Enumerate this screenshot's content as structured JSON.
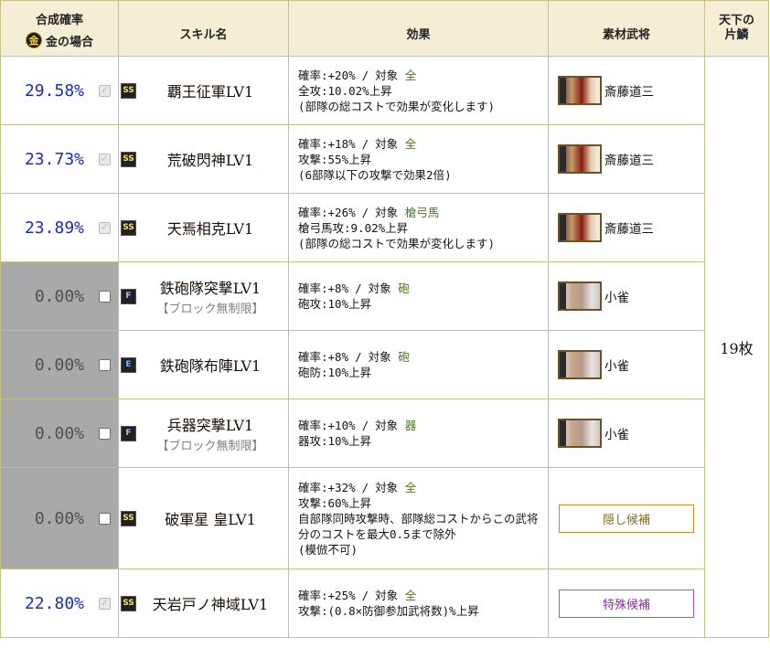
{
  "header": {
    "rate_title": "合成確率",
    "gold_coin": "金",
    "gold_label": "金の場合",
    "skill_name": "スキル名",
    "effect": "効果",
    "material": "素材武将",
    "scale_line1": "天下の",
    "scale_line2": "片鱗"
  },
  "scale_value": "19枚",
  "rows": [
    {
      "rate": "29.58%",
      "checked": true,
      "active": true,
      "rank": "SS",
      "skill": "覇王征軍LV1",
      "note": "",
      "effect": {
        "prob_label": "確率:+20%",
        "sep": "/",
        "target_label": "対象",
        "target": "全",
        "line2": "全攻:10.02%上昇",
        "line3": "(部隊の総コストで効果が変化します)",
        "line4": ""
      },
      "material": {
        "type": "general",
        "name": "斎藤道三",
        "portrait": "dosan"
      }
    },
    {
      "rate": "23.73%",
      "checked": true,
      "active": true,
      "rank": "SS",
      "skill": "荒破閃神LV1",
      "note": "",
      "effect": {
        "prob_label": "確率:+18%",
        "sep": "/",
        "target_label": "対象",
        "target": "全",
        "line2": "攻撃:55%上昇",
        "line3": "(6部隊以下の攻撃で効果2倍)",
        "line4": ""
      },
      "material": {
        "type": "general",
        "name": "斎藤道三",
        "portrait": "dosan"
      }
    },
    {
      "rate": "23.89%",
      "checked": true,
      "active": true,
      "rank": "SS",
      "skill": "天焉相克LV1",
      "note": "",
      "effect": {
        "prob_label": "確率:+26%",
        "sep": "/",
        "target_label": "対象",
        "target": "槍弓馬",
        "line2": "槍弓馬攻:9.02%上昇",
        "line3": "(部隊の総コストで効果が変化します)",
        "line4": ""
      },
      "material": {
        "type": "general",
        "name": "斎藤道三",
        "portrait": "dosan"
      }
    },
    {
      "rate": "0.00%",
      "checked": false,
      "active": false,
      "rank": "F",
      "skill": "鉄砲隊突撃LV1",
      "note": "【ブロック無制限】",
      "effect": {
        "prob_label": "確率:+8%",
        "sep": "/",
        "target_label": "対象",
        "target": "砲",
        "line2": "砲攻:10%上昇",
        "line3": "",
        "line4": ""
      },
      "material": {
        "type": "general",
        "name": "小雀",
        "portrait": "koga"
      }
    },
    {
      "rate": "0.00%",
      "checked": false,
      "active": false,
      "rank": "E",
      "skill": "鉄砲隊布陣LV1",
      "note": "",
      "effect": {
        "prob_label": "確率:+8%",
        "sep": "/",
        "target_label": "対象",
        "target": "砲",
        "line2": "砲防:10%上昇",
        "line3": "",
        "line4": ""
      },
      "material": {
        "type": "general",
        "name": "小雀",
        "portrait": "koga"
      }
    },
    {
      "rate": "0.00%",
      "checked": false,
      "active": false,
      "rank": "F",
      "skill": "兵器突撃LV1",
      "note": "【ブロック無制限】",
      "effect": {
        "prob_label": "確率:+10%",
        "sep": "/",
        "target_label": "対象",
        "target": "器",
        "line2": "器攻:10%上昇",
        "line3": "",
        "line4": ""
      },
      "material": {
        "type": "general",
        "name": "小雀",
        "portrait": "koga"
      }
    },
    {
      "rate": "0.00%",
      "checked": false,
      "active": false,
      "rank": "SS",
      "skill": "破軍星 皇LV1",
      "note": "",
      "effect": {
        "prob_label": "確率:+32%",
        "sep": "/",
        "target_label": "対象",
        "target": "全",
        "line2": "攻撃:60%上昇",
        "line3": "自部隊同時攻撃時、部隊総コストからこの武将分のコストを最大0.5まで除外",
        "line4": "(模倣不可)"
      },
      "material": {
        "type": "button",
        "name": "隠し候補",
        "style": "hidden"
      }
    },
    {
      "rate": "22.80%",
      "checked": true,
      "active": true,
      "rank": "SS",
      "skill": "天岩戸ノ神域LV1",
      "note": "",
      "effect": {
        "prob_label": "確率:+25%",
        "sep": "/",
        "target_label": "対象",
        "target": "全",
        "line2": "攻撃:(0.8×防御参加武将数)%上昇",
        "line3": "",
        "line4": ""
      },
      "material": {
        "type": "button",
        "name": "特殊候補",
        "style": "special"
      }
    }
  ]
}
